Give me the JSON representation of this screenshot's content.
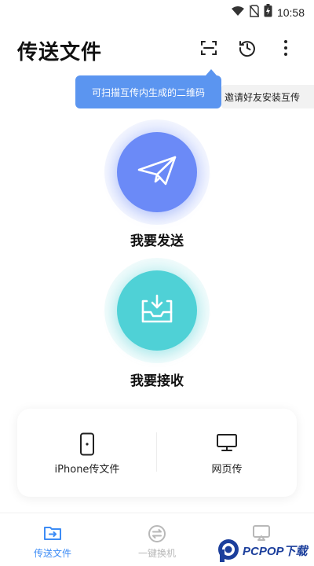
{
  "status_bar": {
    "time": "10:58"
  },
  "header": {
    "title": "传送文件"
  },
  "tooltip": {
    "text": "可扫描互传内生成的二维码"
  },
  "invite": {
    "text": "邀请好友安装互传"
  },
  "actions": {
    "send": {
      "label": "我要发送",
      "color": "#6b8af7"
    },
    "receive": {
      "label": "我要接收",
      "color": "#4fd1d6"
    }
  },
  "card": {
    "items": [
      {
        "label": "iPhone传文件"
      },
      {
        "label": "网页传"
      }
    ]
  },
  "bottom_nav": {
    "active_color": "#3d8cf5",
    "inactive_color": "#b8b8b8",
    "items": [
      {
        "label": "传送文件",
        "active": true
      },
      {
        "label": "一键换机",
        "active": false
      },
      {
        "label": "",
        "active": false
      }
    ]
  },
  "watermark": {
    "text": "PCPOP下载"
  }
}
